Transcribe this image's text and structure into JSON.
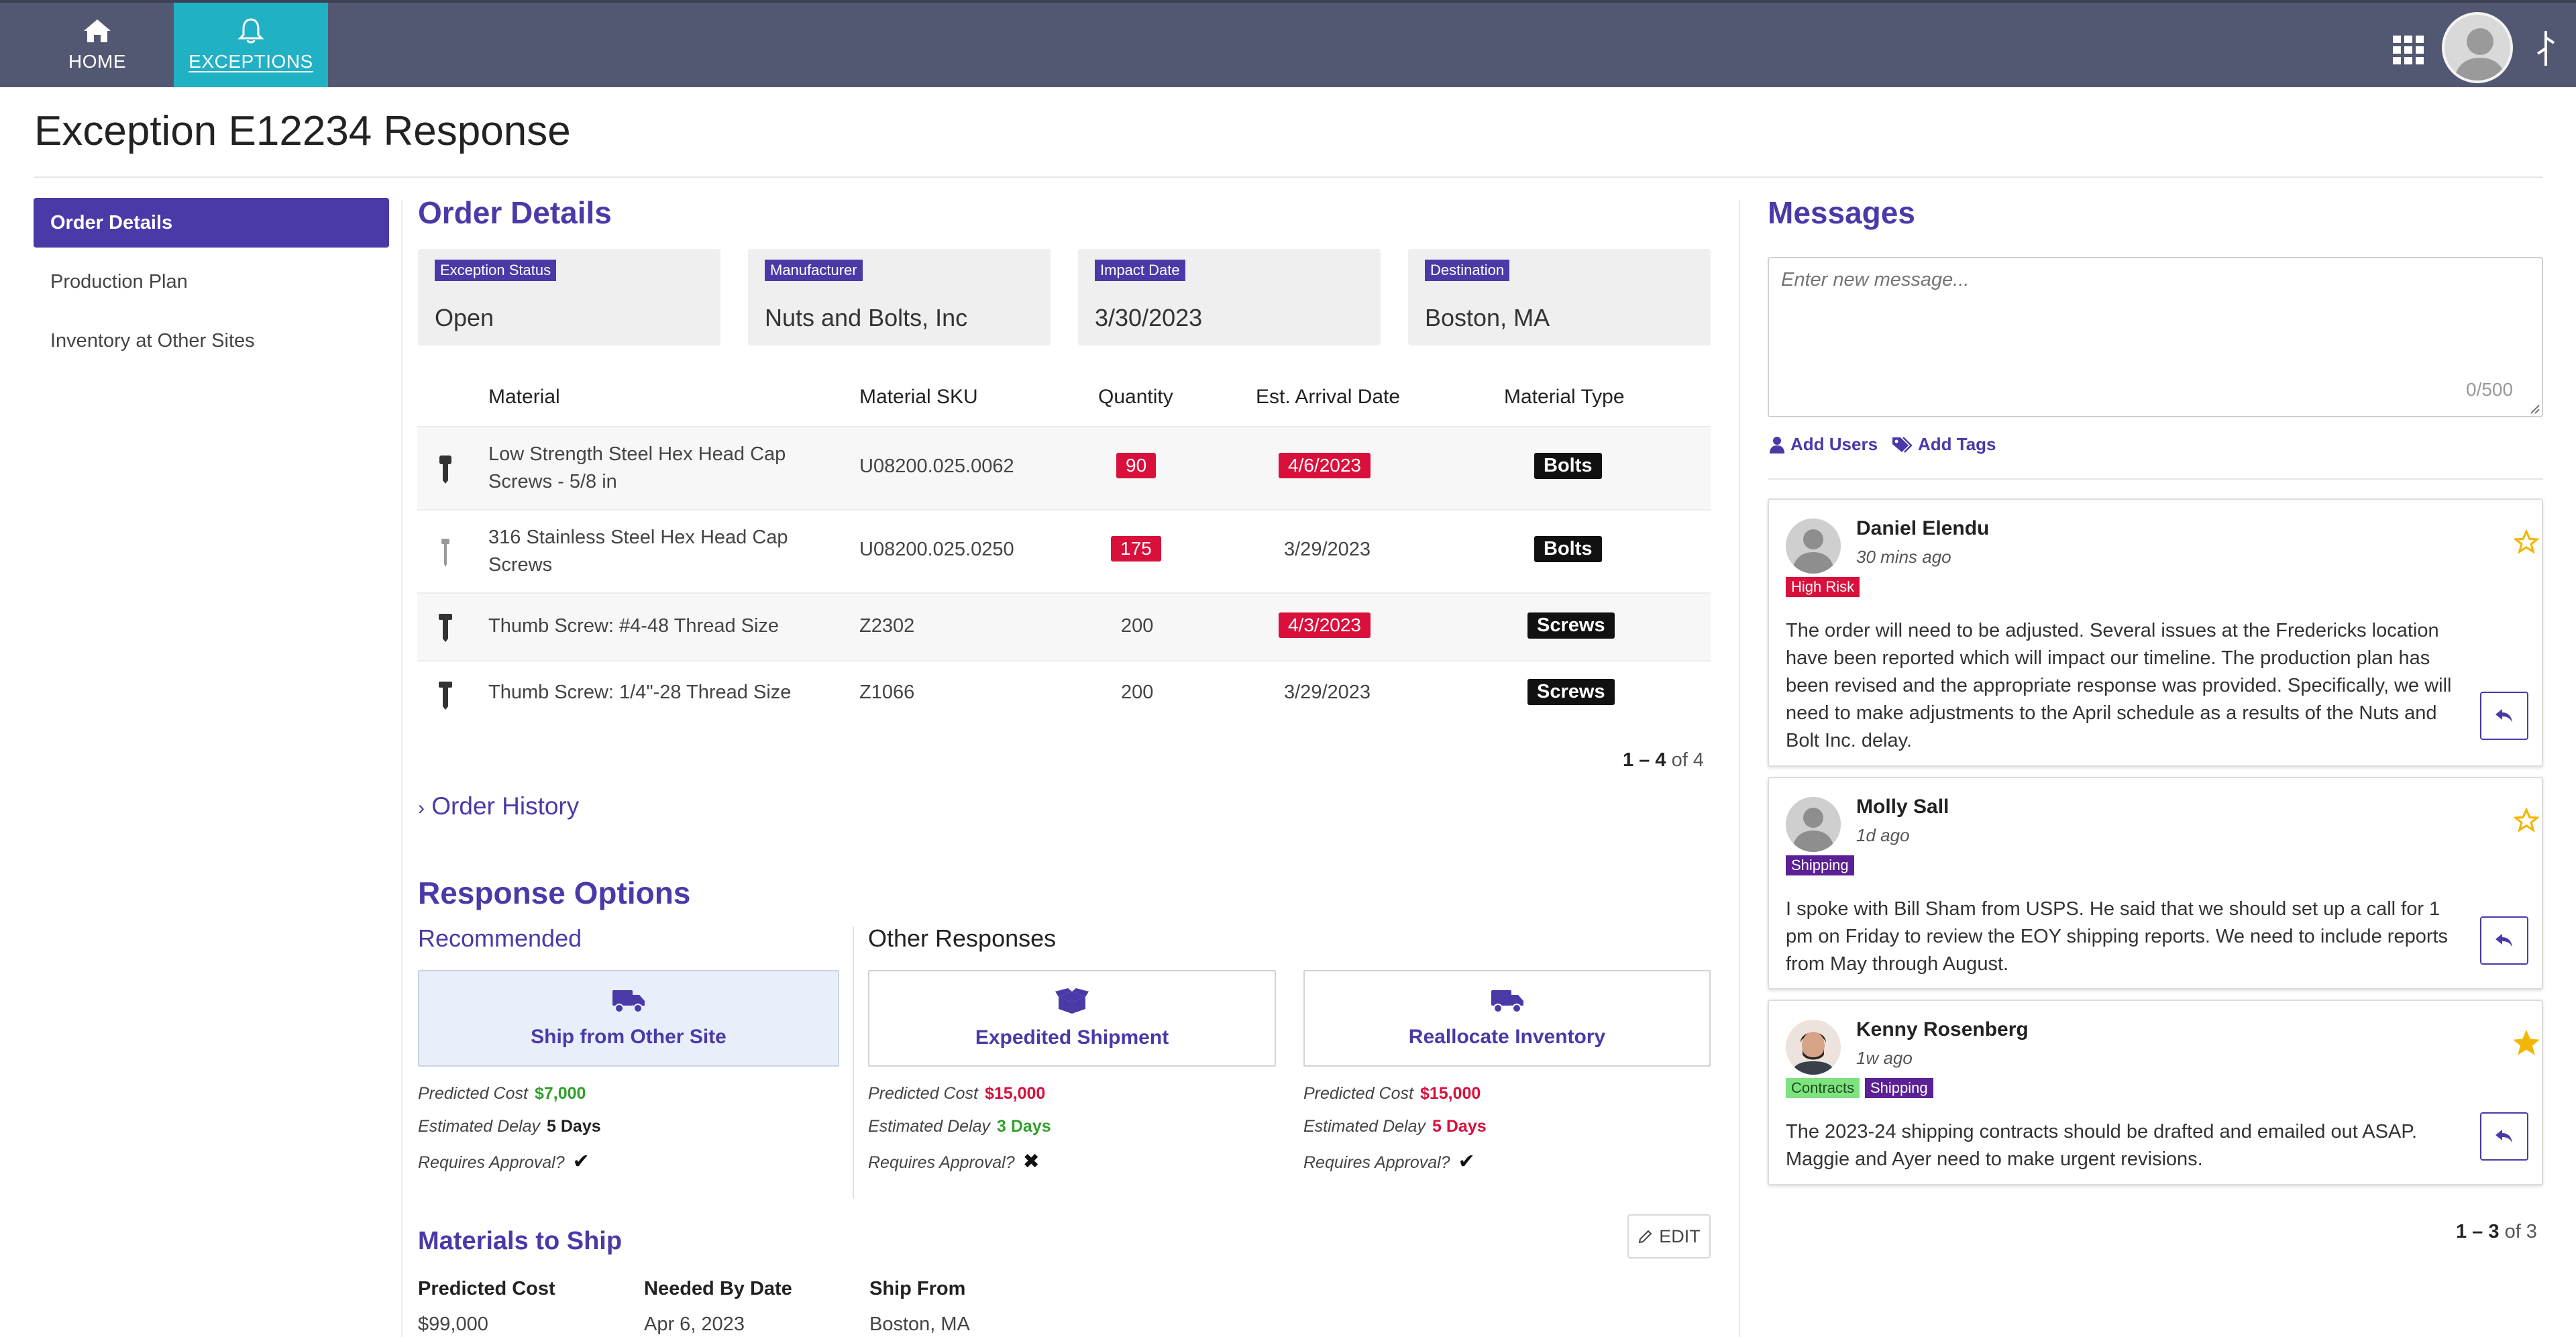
{
  "nav": {
    "home_label": "HOME",
    "exceptions_label": "EXCEPTIONS",
    "active_color": "#21b1c4",
    "bar_color": "#535872"
  },
  "page": {
    "title": "Exception E12234 Response",
    "accent_color": "#4a3aa8"
  },
  "sidebar": {
    "items": [
      {
        "label": "Order Details",
        "active": true
      },
      {
        "label": "Production Plan",
        "active": false
      },
      {
        "label": "Inventory at Other Sites",
        "active": false
      }
    ]
  },
  "order_details": {
    "title": "Order Details",
    "cards": [
      {
        "label": "Exception Status",
        "value": "Open"
      },
      {
        "label": "Manufacturer",
        "value": "Nuts and Bolts, Inc"
      },
      {
        "label": "Impact Date",
        "value": "3/30/2023"
      },
      {
        "label": "Destination",
        "value": "Boston, MA"
      }
    ],
    "table": {
      "columns": [
        "Material",
        "Material SKU",
        "Quantity",
        "Est. Arrival Date",
        "Material Type"
      ],
      "rows": [
        {
          "icon": "hex-bolt-icon",
          "material": "Low Strength Steel Hex Head Cap Screws - 5/8 in",
          "sku": "U08200.025.0062",
          "quantity": "90",
          "quantity_alert": true,
          "arrival": "4/6/2023",
          "arrival_alert": true,
          "type": "Bolts"
        },
        {
          "icon": "thin-screw-icon",
          "material": "316 Stainless Steel Hex Head Cap Screws",
          "sku": "U08200.025.0250",
          "quantity": "175",
          "quantity_alert": true,
          "arrival": "3/29/2023",
          "arrival_alert": false,
          "type": "Bolts"
        },
        {
          "icon": "thumb-screw-icon",
          "material": "Thumb Screw: #4-48 Thread Size",
          "sku": "Z2302",
          "quantity": "200",
          "quantity_alert": false,
          "arrival": "4/3/2023",
          "arrival_alert": true,
          "type": "Screws"
        },
        {
          "icon": "thumb-screw-icon",
          "material": "Thumb Screw: 1/4\"-28 Thread Size",
          "sku": "Z1066",
          "quantity": "200",
          "quantity_alert": false,
          "arrival": "3/29/2023",
          "arrival_alert": false,
          "type": "Screws"
        }
      ],
      "pager": {
        "range": "1 – 4",
        "of": "of 4"
      }
    },
    "order_history_label": "Order History"
  },
  "response_options": {
    "title": "Response Options",
    "recommended_label": "Recommended",
    "other_label": "Other Responses",
    "labels": {
      "cost": "Predicted Cost",
      "delay": "Estimated Delay",
      "approval": "Requires Approval?"
    },
    "options": [
      {
        "name": "Ship from Other Site",
        "icon": "truck-icon",
        "cost": "$7,000",
        "delay": "5 Days",
        "approval": "✔"
      },
      {
        "name": "Expedited Shipment",
        "icon": "open-box-icon",
        "cost": "$15,000",
        "delay": "3 Days",
        "approval": "✖"
      },
      {
        "name": "Reallocate Inventory",
        "icon": "truck-icon",
        "cost": "$15,000",
        "delay": "5 Days",
        "approval": "✔"
      }
    ]
  },
  "materials_to_ship": {
    "title": "Materials to Ship",
    "edit_label": "EDIT",
    "fields": [
      {
        "label": "Predicted Cost",
        "value": "$99,000"
      },
      {
        "label": "Needed By Date",
        "value": "Apr 6, 2023"
      },
      {
        "label": "Ship From",
        "value": "Boston, MA"
      }
    ]
  },
  "messages": {
    "title": "Messages",
    "input_placeholder": "Enter new message...",
    "counter": "0/500",
    "add_users_label": "Add Users",
    "add_tags_label": "Add Tags",
    "items": [
      {
        "name": "Daniel Elendu",
        "time": "30 mins ago",
        "tags": [
          "High Risk"
        ],
        "starred": false,
        "body": "The order will need to be adjusted. Several issues at the Fredericks location have been reported which will impact our timeline. The production plan has been revised and the appropriate response was provided. Specifically, we will need to make adjustments to the April schedule as a results of the Nuts and Bolt Inc. delay."
      },
      {
        "name": "Molly Sall",
        "time": "1d ago",
        "tags": [
          "Shipping"
        ],
        "starred": false,
        "body": "I spoke with Bill Sham from USPS. He said that we should set up a call for 1 pm on Friday to review the EOY shipping reports. We need to include reports from May through August."
      },
      {
        "name": "Kenny Rosenberg",
        "time": "1w ago",
        "tags": [
          "Contracts",
          "Shipping"
        ],
        "starred": true,
        "body": "The 2023-24 shipping contracts should be drafted and emailed out ASAP. Maggie and Ayer need to make urgent revisions."
      }
    ],
    "pager": {
      "range": "1 – 3",
      "of": "of 3"
    }
  }
}
